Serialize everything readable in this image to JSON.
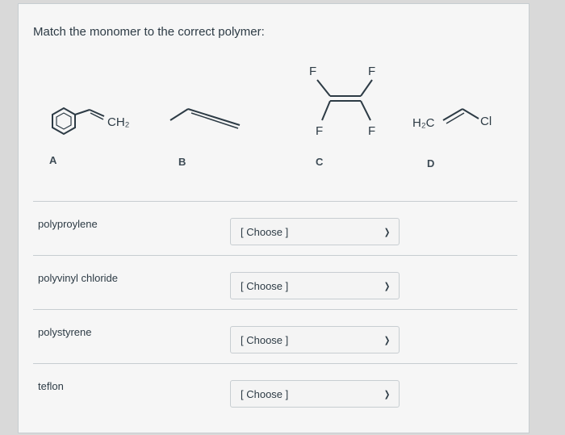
{
  "question": {
    "prompt": "Match the monomer to the correct polymer:"
  },
  "structures": [
    {
      "id": "A",
      "label": "A",
      "text": "CH2"
    },
    {
      "id": "B",
      "label": "B"
    },
    {
      "id": "C",
      "label": "C",
      "atoms": [
        "F",
        "F",
        "F",
        "F"
      ]
    },
    {
      "id": "D",
      "label": "D",
      "left": "H2C",
      "right": "Cl"
    }
  ],
  "rows": [
    {
      "polymer": "polyproylene",
      "selection": "[ Choose ]"
    },
    {
      "polymer": "polyvinyl chloride",
      "selection": "[ Choose ]"
    },
    {
      "polymer": "polystyrene",
      "selection": "[ Choose ]"
    },
    {
      "polymer": "teflon",
      "selection": "[ Choose ]"
    }
  ],
  "icons": {
    "dropdown": "chevron-down-icon"
  }
}
